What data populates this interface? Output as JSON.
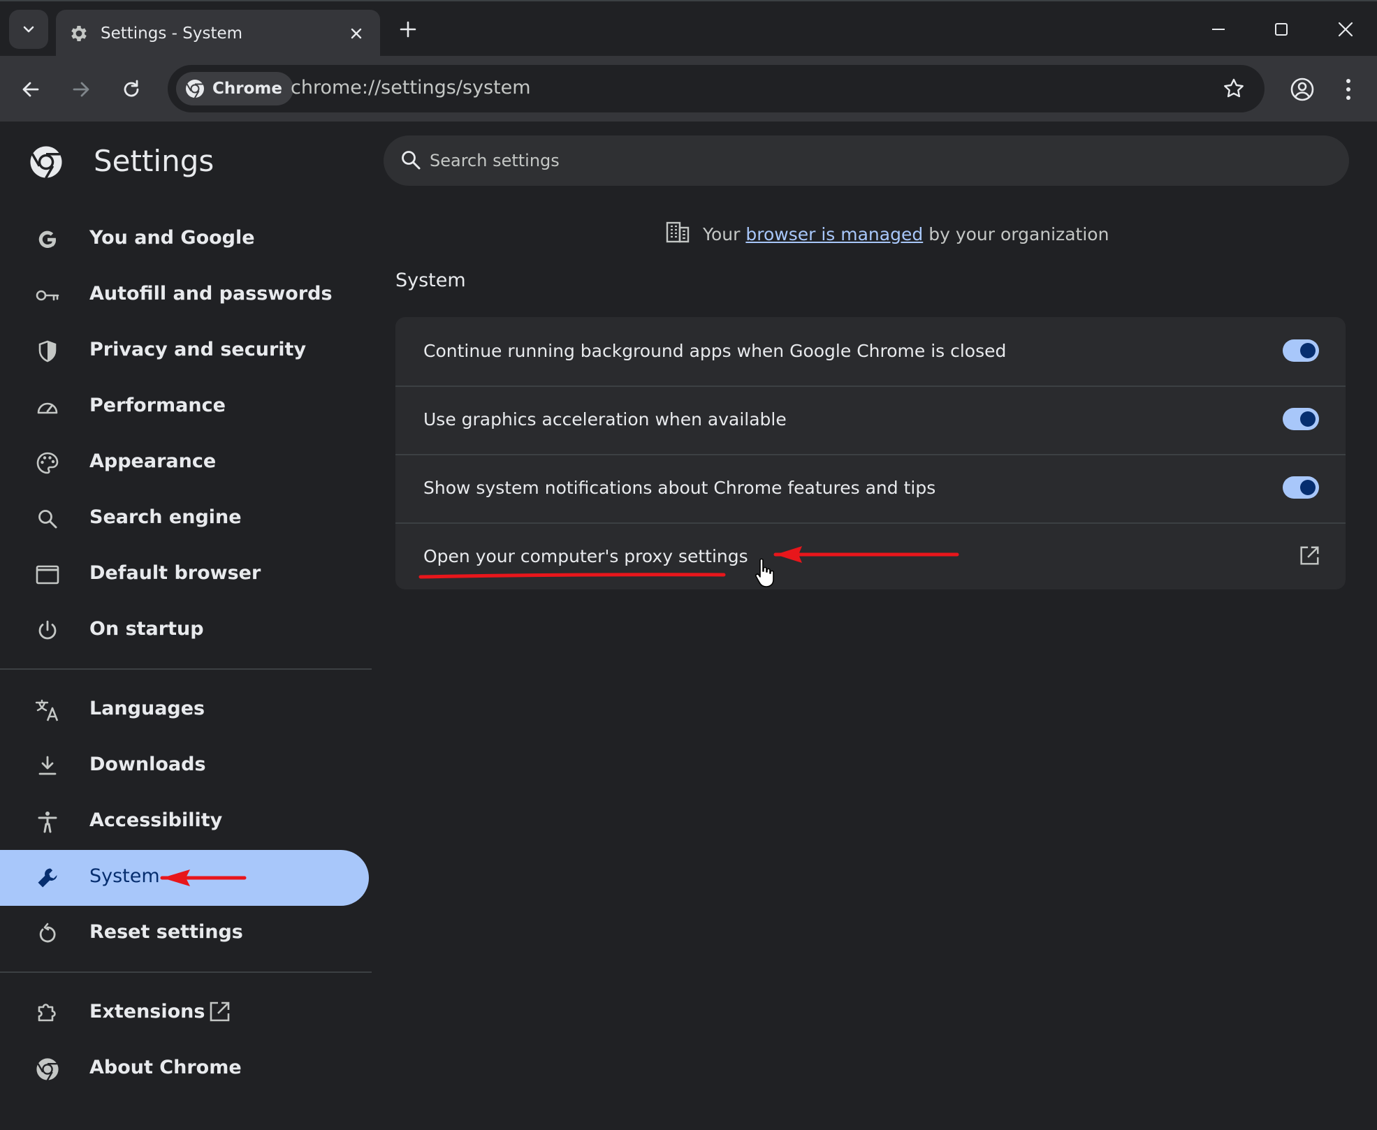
{
  "window": {
    "tab_title": "Settings - System",
    "new_tab_symbol": "+"
  },
  "toolbar": {
    "chip_label": "Chrome",
    "url": "chrome://settings/system"
  },
  "sidebar": {
    "title": "Settings",
    "items": [
      {
        "label": "You and Google",
        "icon": "google-g-icon"
      },
      {
        "label": "Autofill and passwords",
        "icon": "key-icon"
      },
      {
        "label": "Privacy and security",
        "icon": "shield-icon"
      },
      {
        "label": "Performance",
        "icon": "speedometer-icon"
      },
      {
        "label": "Appearance",
        "icon": "palette-icon"
      },
      {
        "label": "Search engine",
        "icon": "search-icon"
      },
      {
        "label": "Default browser",
        "icon": "browser-window-icon"
      },
      {
        "label": "On startup",
        "icon": "power-icon"
      },
      {
        "label": "Languages",
        "icon": "translate-icon"
      },
      {
        "label": "Downloads",
        "icon": "download-icon"
      },
      {
        "label": "Accessibility",
        "icon": "accessibility-icon"
      },
      {
        "label": "System",
        "icon": "wrench-icon",
        "active": true
      },
      {
        "label": "Reset settings",
        "icon": "reset-icon"
      },
      {
        "label": "Extensions",
        "icon": "puzzle-icon"
      },
      {
        "label": "About Chrome",
        "icon": "chrome-logo-icon"
      }
    ]
  },
  "main": {
    "search_placeholder": "Search settings",
    "managed": {
      "prefix": "Your",
      "link": "browser is managed",
      "suffix": "by your organization"
    },
    "section_title": "System",
    "rows": [
      {
        "label": "Continue running background apps when Google Chrome is closed",
        "type": "toggle",
        "enabled": true
      },
      {
        "label": "Use graphics acceleration when available",
        "type": "toggle",
        "enabled": true
      },
      {
        "label": "Show system notifications about Chrome features and tips",
        "type": "toggle",
        "enabled": true
      },
      {
        "label": "Open your computer's proxy settings",
        "type": "external-link"
      }
    ]
  },
  "colors": {
    "background": "#202124",
    "toolbar": "#35363a",
    "accent": "#a8c7fa",
    "accent_dark": "#062e6f",
    "annotation": "#e8161b"
  }
}
